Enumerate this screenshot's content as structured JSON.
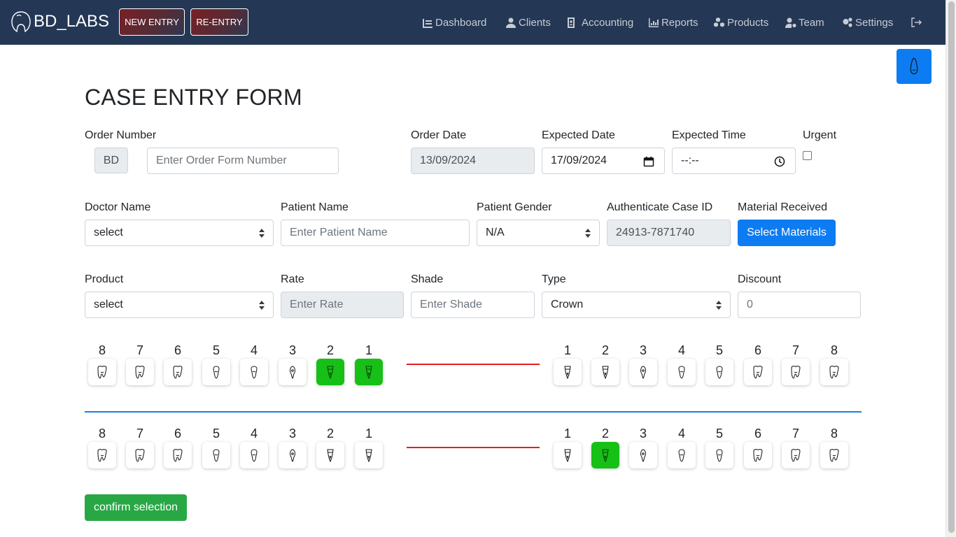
{
  "navbar": {
    "brand": "BD_LABS",
    "new_entry": "NEW ENTRY",
    "re_entry": "RE-ENTRY",
    "items": [
      {
        "label": "Dashboard",
        "icon": "dashboard-icon"
      },
      {
        "label": "Clients",
        "icon": "user-icon"
      },
      {
        "label": "Accounting",
        "icon": "id-badge-icon"
      },
      {
        "label": "Reports",
        "icon": "chart-icon"
      },
      {
        "label": "Products",
        "icon": "cubes-icon"
      },
      {
        "label": "Team",
        "icon": "user-cog-icon"
      },
      {
        "label": "Settings",
        "icon": "gears-icon"
      }
    ]
  },
  "form": {
    "title": "CASE ENTRY FORM",
    "order_number": {
      "label": "Order Number",
      "prefix": "BD",
      "placeholder": "Enter Order Form Number"
    },
    "order_date": {
      "label": "Order Date",
      "value": "13/09/2024"
    },
    "expected_date": {
      "label": "Expected Date",
      "value": "17/09/2024"
    },
    "expected_time": {
      "label": "Expected Time",
      "value": "--:--"
    },
    "urgent": {
      "label": "Urgent",
      "checked": false
    },
    "doctor_name": {
      "label": "Doctor Name",
      "value": "select"
    },
    "patient_name": {
      "label": "Patient Name",
      "placeholder": "Enter Patient Name"
    },
    "patient_gender": {
      "label": "Patient Gender",
      "value": "N/A"
    },
    "case_id": {
      "label": "Authenticate Case ID",
      "value": "24913-7871740"
    },
    "material": {
      "label": "Material Received",
      "button": "Select Materials"
    },
    "product": {
      "label": "Product",
      "value": "select"
    },
    "rate": {
      "label": "Rate",
      "placeholder": "Enter Rate"
    },
    "shade": {
      "label": "Shade",
      "placeholder": "Enter Shade"
    },
    "type": {
      "label": "Type",
      "value": "Crown"
    },
    "discount": {
      "label": "Discount",
      "placeholder": "0"
    }
  },
  "teeth": {
    "upper_left": [
      "8",
      "7",
      "6",
      "5",
      "4",
      "3",
      "2",
      "1"
    ],
    "upper_right": [
      "1",
      "2",
      "3",
      "4",
      "5",
      "6",
      "7",
      "8"
    ],
    "lower_left": [
      "8",
      "7",
      "6",
      "5",
      "4",
      "3",
      "2",
      "1"
    ],
    "lower_right": [
      "1",
      "2",
      "3",
      "4",
      "5",
      "6",
      "7",
      "8"
    ],
    "selected": {
      "upper_left": [
        "2",
        "1"
      ],
      "upper_right": [],
      "lower_left": [],
      "lower_right": [
        "2"
      ]
    }
  },
  "confirm_button": "confirm selection",
  "colors": {
    "navbar": "#243755",
    "primary": "#0d7cf2",
    "selected_tooth": "#16c016",
    "success": "#28a745",
    "divider_red": "#e02020",
    "divider_blue": "#1f7ee6"
  }
}
